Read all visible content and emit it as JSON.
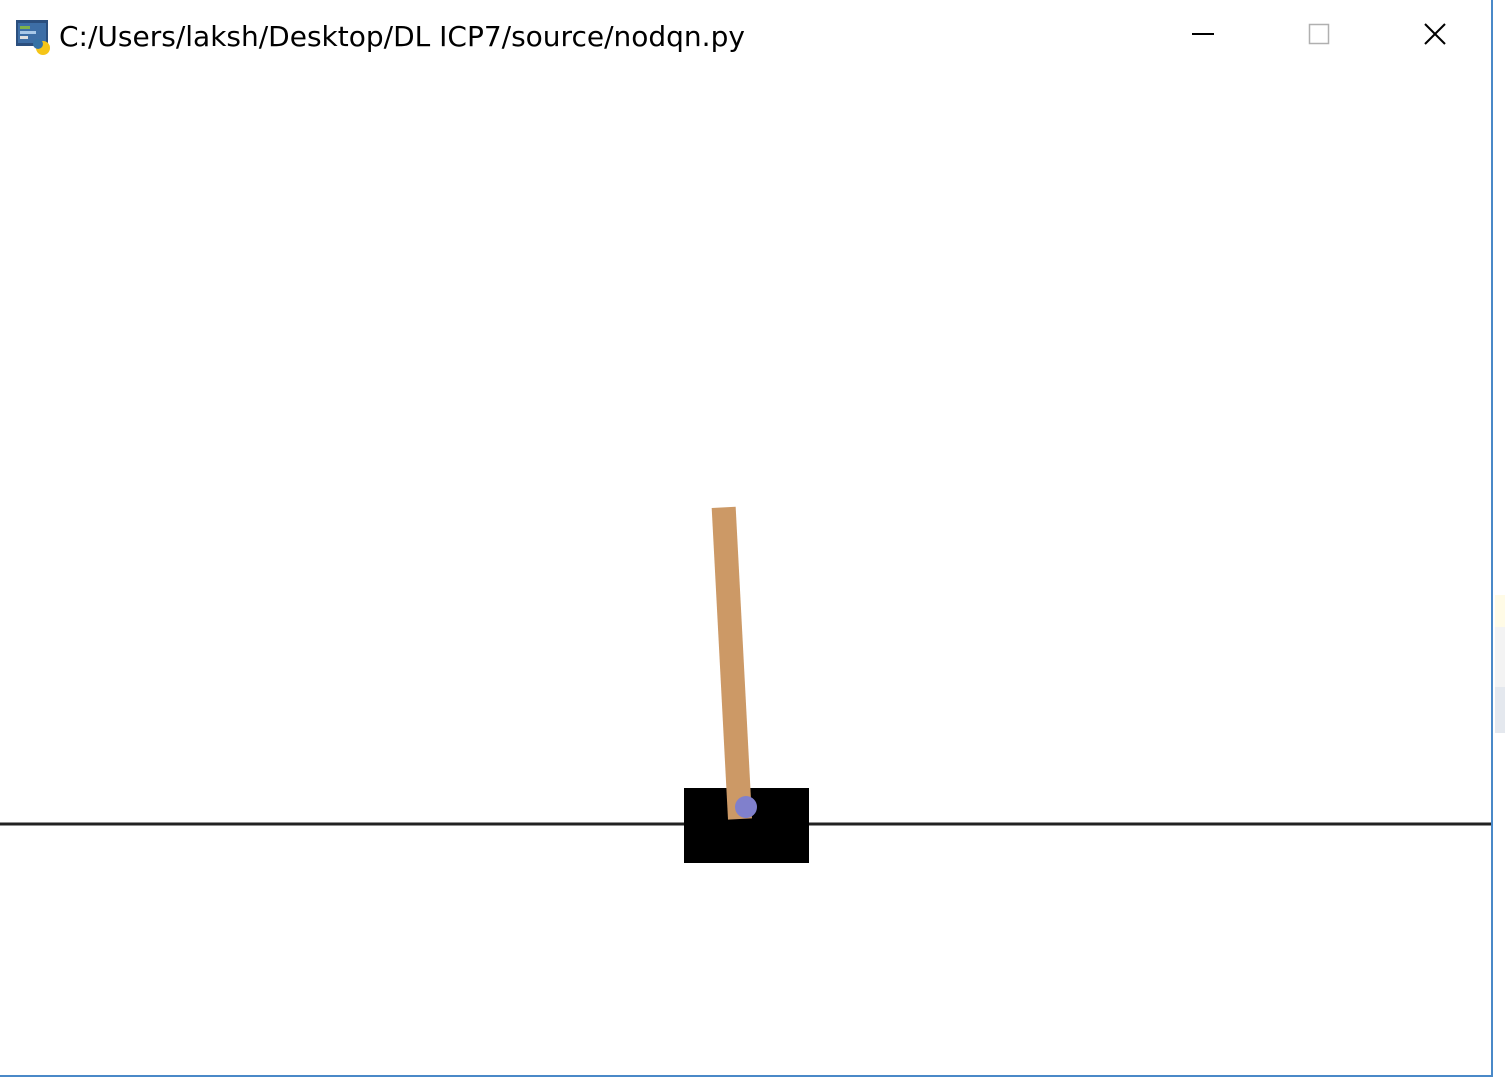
{
  "window": {
    "title": "C:/Users/laksh/Desktop/DL ICP7/source/nodqn.py",
    "app_icon": "python-app-icon",
    "controls": {
      "minimize_icon": "minimize-icon",
      "maximize_icon": "maximize-icon",
      "close_icon": "close-icon"
    }
  },
  "scene": {
    "environment": "CartPole",
    "pole_angle_deg": -3,
    "colors": {
      "track": "#222222",
      "cart": "#000000",
      "pole": "#cc9966",
      "axle": "#8080cc",
      "background": "#ffffff"
    }
  }
}
